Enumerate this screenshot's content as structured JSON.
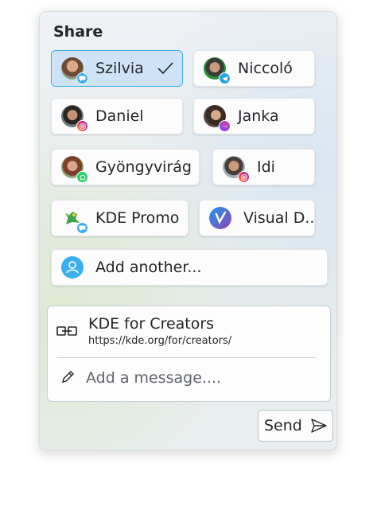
{
  "panel": {
    "title": "Share",
    "contacts": [
      {
        "name": "Szilvia",
        "selected": true,
        "badge": "chat-icon"
      },
      {
        "name": "Niccoló",
        "selected": false,
        "badge": "telegram-icon"
      },
      {
        "name": "Daniel",
        "selected": false,
        "badge": "instagram-icon"
      },
      {
        "name": "Janka",
        "selected": false,
        "badge": "messenger-icon"
      },
      {
        "name": "Gyöngyvirág",
        "selected": false,
        "badge": "whatsapp-icon"
      },
      {
        "name": "Idi",
        "selected": false,
        "badge": "instagram-icon"
      },
      {
        "name": "KDE Promo",
        "selected": false,
        "badge": "chat-icon"
      },
      {
        "name": "Visual D...",
        "selected": false,
        "badge": ""
      }
    ],
    "add_another": "Add another...",
    "link": {
      "title": "KDE for Creators",
      "url": "https://kde.org/for/creators/"
    },
    "message": {
      "placeholder": "Add a message...."
    },
    "send_label": "Send"
  },
  "colors": {
    "accent": "#3daee9",
    "selected_bg": "#cfe3f6",
    "text": "#232629"
  }
}
